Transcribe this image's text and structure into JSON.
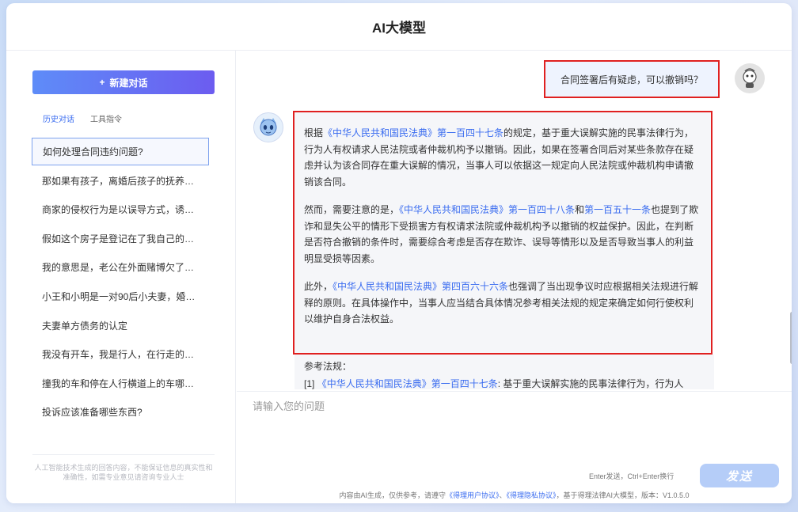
{
  "app": {
    "title": "AI大模型"
  },
  "sidebar": {
    "new_chat_label": "新建对话",
    "tabs": [
      {
        "label": "历史对话",
        "active": true
      },
      {
        "label": "工具指令",
        "active": false
      }
    ],
    "history": [
      "如何处理合同违约问题?",
      "那如果有孩子，离婚后孩子的抚养权…",
      "商家的侵权行为是以误导方式，诱使…",
      "假如这个房子是登记在了我自己的名…",
      "我的意思是，老公在外面赌博欠了债…",
      "小王和小明是一对90后小夫妻，婚后…",
      "夫妻单方债务的认定",
      "我没有开车，我是行人，在行走的时…",
      "撞我的车和停在人行横道上的车哪一…",
      "投诉应该准备哪些东西?"
    ],
    "disclaimer": "人工智能技术生成的回答内容，不能保证信息的真实性和准确性，如需专业意见请咨询专业人士"
  },
  "chat": {
    "user_message": "合同签署后有疑虑，可以撤销吗？",
    "answer": {
      "p1": {
        "a": "根据",
        "law": "《中华人民共和国民法典》第一百四十七条",
        "b": "的规定，基于重大误解实施的民事法律行为，行为人有权请求人民法院或者仲裁机构予以撤销。因此，如果在签署合同后对某些条款存在疑虑并认为该合同存在重大误解的情况，当事人可以依据这一规定向人民法院或仲裁机构申请撤销该合同。"
      },
      "p2": {
        "a": "然而，需要注意的是，",
        "law1": "《中华人民共和国民法典》第一百四十八条",
        "mid": "和",
        "law2": "第一百五十一条",
        "b": "也提到了欺诈和显失公平的情形下受损害方有权请求法院或仲裁机构予以撤销的权益保护。因此，在判断是否符合撤销的条件时，需要综合考虑是否存在欺诈、误导等情形以及是否导致当事人的利益明显受损等因素。"
      },
      "p3": {
        "a": "此外，",
        "law": "《中华人民共和国民法典》第四百六十六条",
        "b": "也强调了当出现争议时应根据相关法规进行解释的原则。在具体操作中，当事人应当结合具体情况参考相关法规的规定来确定如何行使权利以维护自身合法权益。"
      }
    },
    "refs": {
      "title": "参考法规：",
      "item1_prefix": "[1] ",
      "item1_law": "《中华人民共和国民法典》第一百四十七条",
      "item1_text": ": 基于重大误解实施的民事法律行为，行为人"
    }
  },
  "input": {
    "placeholder": "请输入您的问题",
    "hint": "Enter发送，Ctrl+Enter换行",
    "send_label": "发送"
  },
  "footer": {
    "a": "内容由AI生成，仅供参考，请遵守",
    "link1": "《得理用户协议》",
    "sep": "、",
    "link2": "《得理隐私协议》",
    "b": "，基于得理法律AI大模型，版本：V1.0.5.0"
  }
}
